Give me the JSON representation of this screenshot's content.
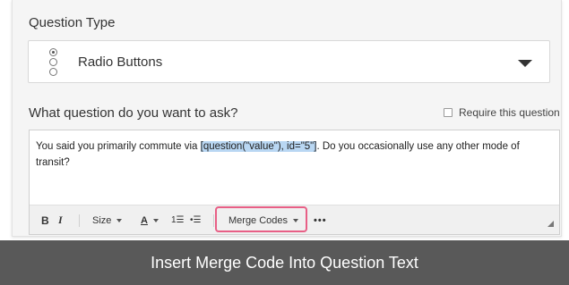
{
  "question_type": {
    "label": "Question Type",
    "selected_value": "Radio Buttons",
    "icon": "radio-buttons-icon"
  },
  "question": {
    "label": "What question do you want to ask?",
    "require_label": "Require this question",
    "require_checked": false,
    "text_before": "You said you primarily commute via ",
    "merge_code": "[question(\"value\"), id=\"5\"]",
    "text_after": ". Do you occasionally use any other mode of transit?"
  },
  "toolbar": {
    "bold": "B",
    "italic": "I",
    "size": "Size",
    "font_color": "A",
    "ordered_list": "1☰",
    "unordered_list": "•☰",
    "merge_codes": "Merge Codes",
    "more": "•••"
  },
  "caption": "Insert Merge Code Into Question Text",
  "colors": {
    "highlight": "#e85f86",
    "selection": "#b9d7f3",
    "caption_bg": "#595959"
  }
}
